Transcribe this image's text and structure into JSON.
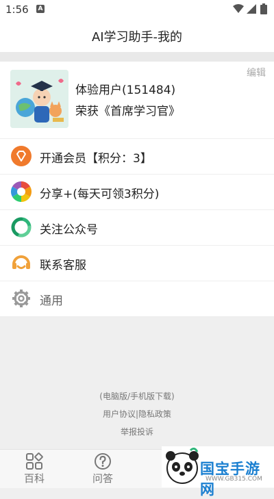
{
  "status": {
    "time": "1:56",
    "notif": "A"
  },
  "header": {
    "title": "AI学习助手-我的"
  },
  "profile": {
    "name": "体验用户(151484)",
    "honor": "荣获《首席学习官》",
    "edit_label": "编辑"
  },
  "menu": [
    {
      "label": "开通会员【积分：3】",
      "icon": "diamond-icon",
      "color": "#f07a2c"
    },
    {
      "label": "分享+(每天可领3积分)",
      "icon": "share-aperture-icon",
      "color": "#e84c3d"
    },
    {
      "label": "关注公众号",
      "icon": "wechat-follow-icon",
      "color": "#2fb67a"
    },
    {
      "label": "联系客服",
      "icon": "customer-service-icon",
      "color": "#f0a13a"
    },
    {
      "label": "通用",
      "icon": "gear-icon",
      "color": "#999999"
    }
  ],
  "footer": {
    "download": "(电脑版/手机版下载)",
    "policy": "用户协议|隐私政策",
    "report": "举报投诉"
  },
  "tabs": [
    {
      "label": "百科",
      "icon": "grid-icon"
    },
    {
      "label": "问答",
      "icon": "question-icon"
    }
  ],
  "watermark": {
    "text": "国宝手游网",
    "url": "WWW.GB315.COM"
  }
}
